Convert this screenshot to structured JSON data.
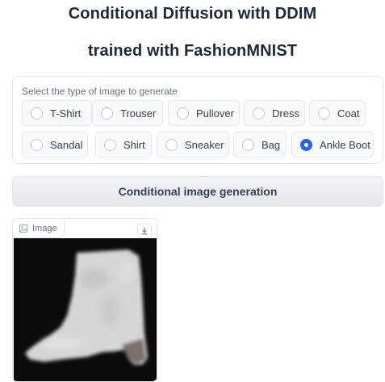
{
  "header": {
    "title_line1": "Conditional Diffusion with DDIM",
    "title_line2": "trained with FashionMNIST"
  },
  "radio_group": {
    "label": "Select the type of image to generate",
    "selected": "Ankle Boot",
    "options": [
      {
        "label": "T-Shirt",
        "selected": false
      },
      {
        "label": "Trouser",
        "selected": false
      },
      {
        "label": "Pullover",
        "selected": false
      },
      {
        "label": "Dress",
        "selected": false
      },
      {
        "label": "Coat",
        "selected": false
      },
      {
        "label": "Sandal",
        "selected": false
      },
      {
        "label": "Shirt",
        "selected": false
      },
      {
        "label": "Sneaker",
        "selected": false
      },
      {
        "label": "Bag",
        "selected": false
      },
      {
        "label": "Ankle Boot",
        "selected": true
      }
    ]
  },
  "actions": {
    "generate_label": "Conditional image generation"
  },
  "output_image": {
    "label": "Image",
    "label_icon": "image-icon",
    "download_icon": "download-icon",
    "content": "grayscale ankle boot on black background"
  },
  "colors": {
    "accent": "#2563eb",
    "panel_border": "#e5e7eb",
    "button_bg": "#e5e7eb"
  }
}
